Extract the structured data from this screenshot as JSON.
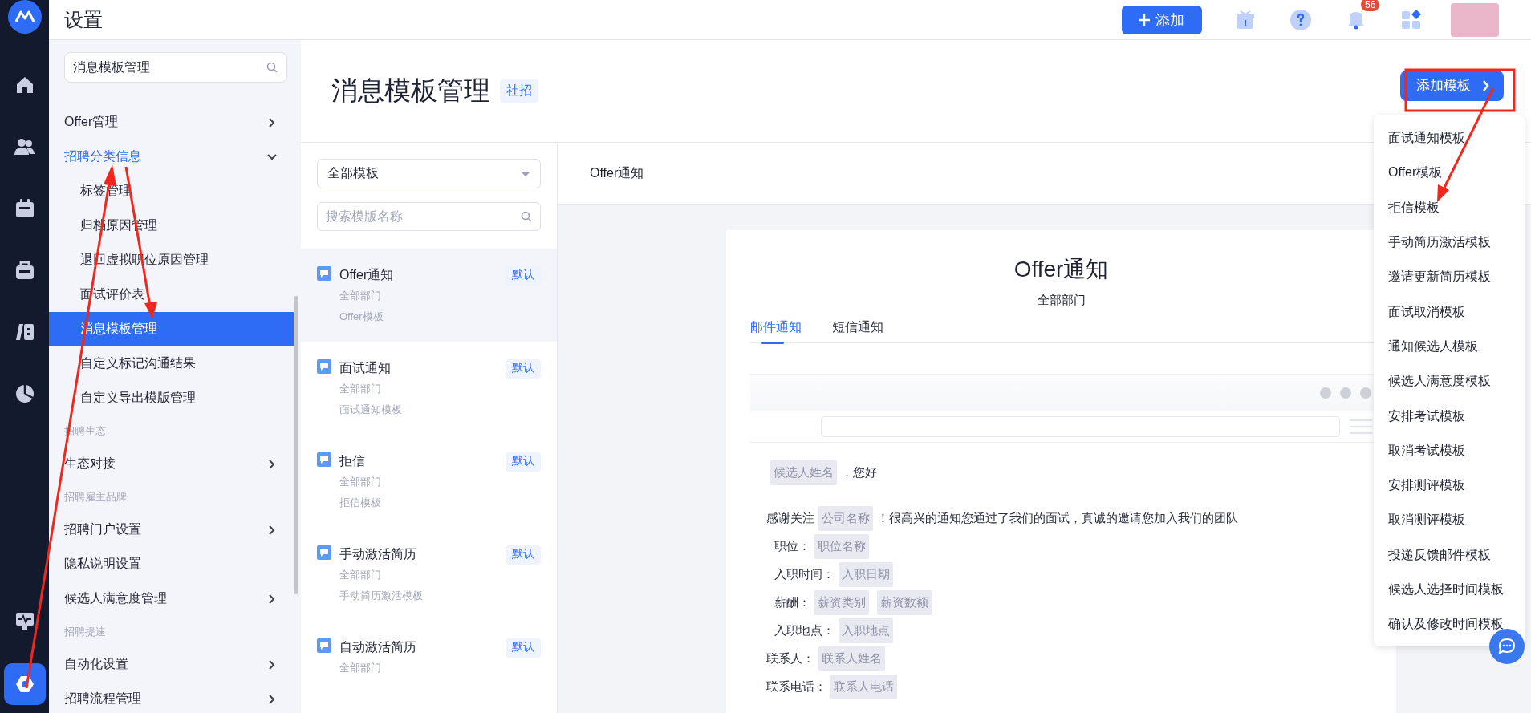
{
  "rail": {
    "items": [
      {
        "kind": "home",
        "selected": false
      },
      {
        "kind": "people",
        "selected": false
      },
      {
        "kind": "calendar",
        "selected": false
      },
      {
        "kind": "briefcase",
        "selected": false
      },
      {
        "kind": "book",
        "selected": false
      },
      {
        "kind": "pie",
        "selected": false
      }
    ],
    "bottom_items": [
      {
        "kind": "monitor",
        "selected": false
      },
      {
        "kind": "settings",
        "selected": true
      }
    ]
  },
  "topbar": {
    "title": "设置",
    "add_button": "添加",
    "notification_badge": "56"
  },
  "settings_sidebar": {
    "search": {
      "value": "消息模板管理"
    },
    "items": [
      {
        "kind": "link",
        "label": "Offer管理",
        "expanded": false
      },
      {
        "kind": "link",
        "label": "招聘分类信息",
        "expanded": true,
        "children": [
          {
            "label": "标签管理",
            "selected": false
          },
          {
            "label": "归档原因管理",
            "selected": false
          },
          {
            "label": "退回虚拟职位原因管理",
            "selected": false
          },
          {
            "label": "面试评价表",
            "selected": false
          },
          {
            "label": "消息模板管理",
            "selected": true
          },
          {
            "label": "自定义标记沟通结果",
            "selected": false
          },
          {
            "label": "自定义导出模版管理",
            "selected": false
          }
        ]
      },
      {
        "kind": "header",
        "label": "招聘生态"
      },
      {
        "kind": "link",
        "label": "生态对接",
        "expanded": false
      },
      {
        "kind": "header",
        "label": "招聘雇主品牌"
      },
      {
        "kind": "link",
        "label": "招聘门户设置",
        "expanded": false
      },
      {
        "kind": "plain",
        "label": "隐私说明设置"
      },
      {
        "kind": "link",
        "label": "候选人满意度管理",
        "expanded": false
      },
      {
        "kind": "header",
        "label": "招聘提速"
      },
      {
        "kind": "link",
        "label": "自动化设置",
        "expanded": false
      },
      {
        "kind": "link",
        "label": "招聘流程管理",
        "expanded": false
      }
    ]
  },
  "page": {
    "title": "消息模板管理",
    "tag": "社招",
    "add_template_button": "添加模板"
  },
  "template_list": {
    "filter": "全部模板",
    "search": {
      "placeholder": "搜索模版名称"
    },
    "items": [
      {
        "name": "Offer通知",
        "department": "全部部门",
        "type": "Offer模板",
        "badge": "默认",
        "selected": true
      },
      {
        "name": "面试通知",
        "department": "全部部门",
        "type": "面试通知模板",
        "badge": "默认",
        "selected": false
      },
      {
        "name": "拒信",
        "department": "全部部门",
        "type": "拒信模板",
        "badge": "默认",
        "selected": false
      },
      {
        "name": "手动激活简历",
        "department": "全部部门",
        "type": "手动简历激活模板",
        "badge": "默认",
        "selected": false
      },
      {
        "name": "自动激活简历",
        "department": "全部部门",
        "badge": "默认",
        "selected": false
      }
    ]
  },
  "preview": {
    "header": "Offer通知",
    "title": "Offer通知",
    "department": "全部部门",
    "tabs": [
      {
        "label": "邮件通知",
        "selected": true
      },
      {
        "label": "短信通知",
        "selected": false
      }
    ],
    "email": {
      "paragraphs": [
        {
          "lines": [
            {
              "indented": false,
              "parts": [
                {
                  "kind": "var",
                  "text": "候选人姓名"
                },
                {
                  "kind": "text",
                  "text": "，您好"
                }
              ]
            }
          ]
        },
        {
          "lines": [
            {
              "indented": false,
              "parts": [
                {
                  "kind": "text",
                  "text": "感谢关注"
                },
                {
                  "kind": "var",
                  "text": "公司名称"
                },
                {
                  "kind": "text",
                  "text": "！很高兴的通知您通过了我们的面试，真诚的邀请您加入我们的团队"
                }
              ]
            },
            {
              "indented": true,
              "parts": [
                {
                  "kind": "text",
                  "text": "职位："
                },
                {
                  "kind": "var",
                  "text": "职位名称"
                }
              ]
            },
            {
              "indented": true,
              "parts": [
                {
                  "kind": "text",
                  "text": "入职时间："
                },
                {
                  "kind": "var",
                  "text": "入职日期"
                }
              ]
            },
            {
              "indented": true,
              "parts": [
                {
                  "kind": "text",
                  "text": "薪酬："
                },
                {
                  "kind": "var",
                  "text": "薪资类别"
                },
                {
                  "kind": "var",
                  "text": "薪资数额"
                }
              ]
            },
            {
              "indented": true,
              "parts": [
                {
                  "kind": "text",
                  "text": "入职地点："
                },
                {
                  "kind": "var",
                  "text": "入职地点"
                }
              ]
            },
            {
              "indented": false,
              "parts": [
                {
                  "kind": "text",
                  "text": "联系人："
                },
                {
                  "kind": "var",
                  "text": "联系人姓名"
                }
              ]
            },
            {
              "indented": false,
              "parts": [
                {
                  "kind": "text",
                  "text": "联系电话："
                },
                {
                  "kind": "var",
                  "text": "联系人电话"
                }
              ]
            }
          ]
        }
      ]
    }
  },
  "add_template_menu": {
    "items": [
      "面试通知模板",
      "Offer模板",
      "拒信模板",
      "手动简历激活模板",
      "邀请更新简历模板",
      "面试取消模板",
      "通知候选人模板",
      "候选人满意度模板",
      "安排考试模板",
      "取消考试模板",
      "安排测评模板",
      "取消测评模板",
      "投递反馈邮件模板",
      "候选人选择时间模板",
      "确认及修改时间模板"
    ]
  }
}
